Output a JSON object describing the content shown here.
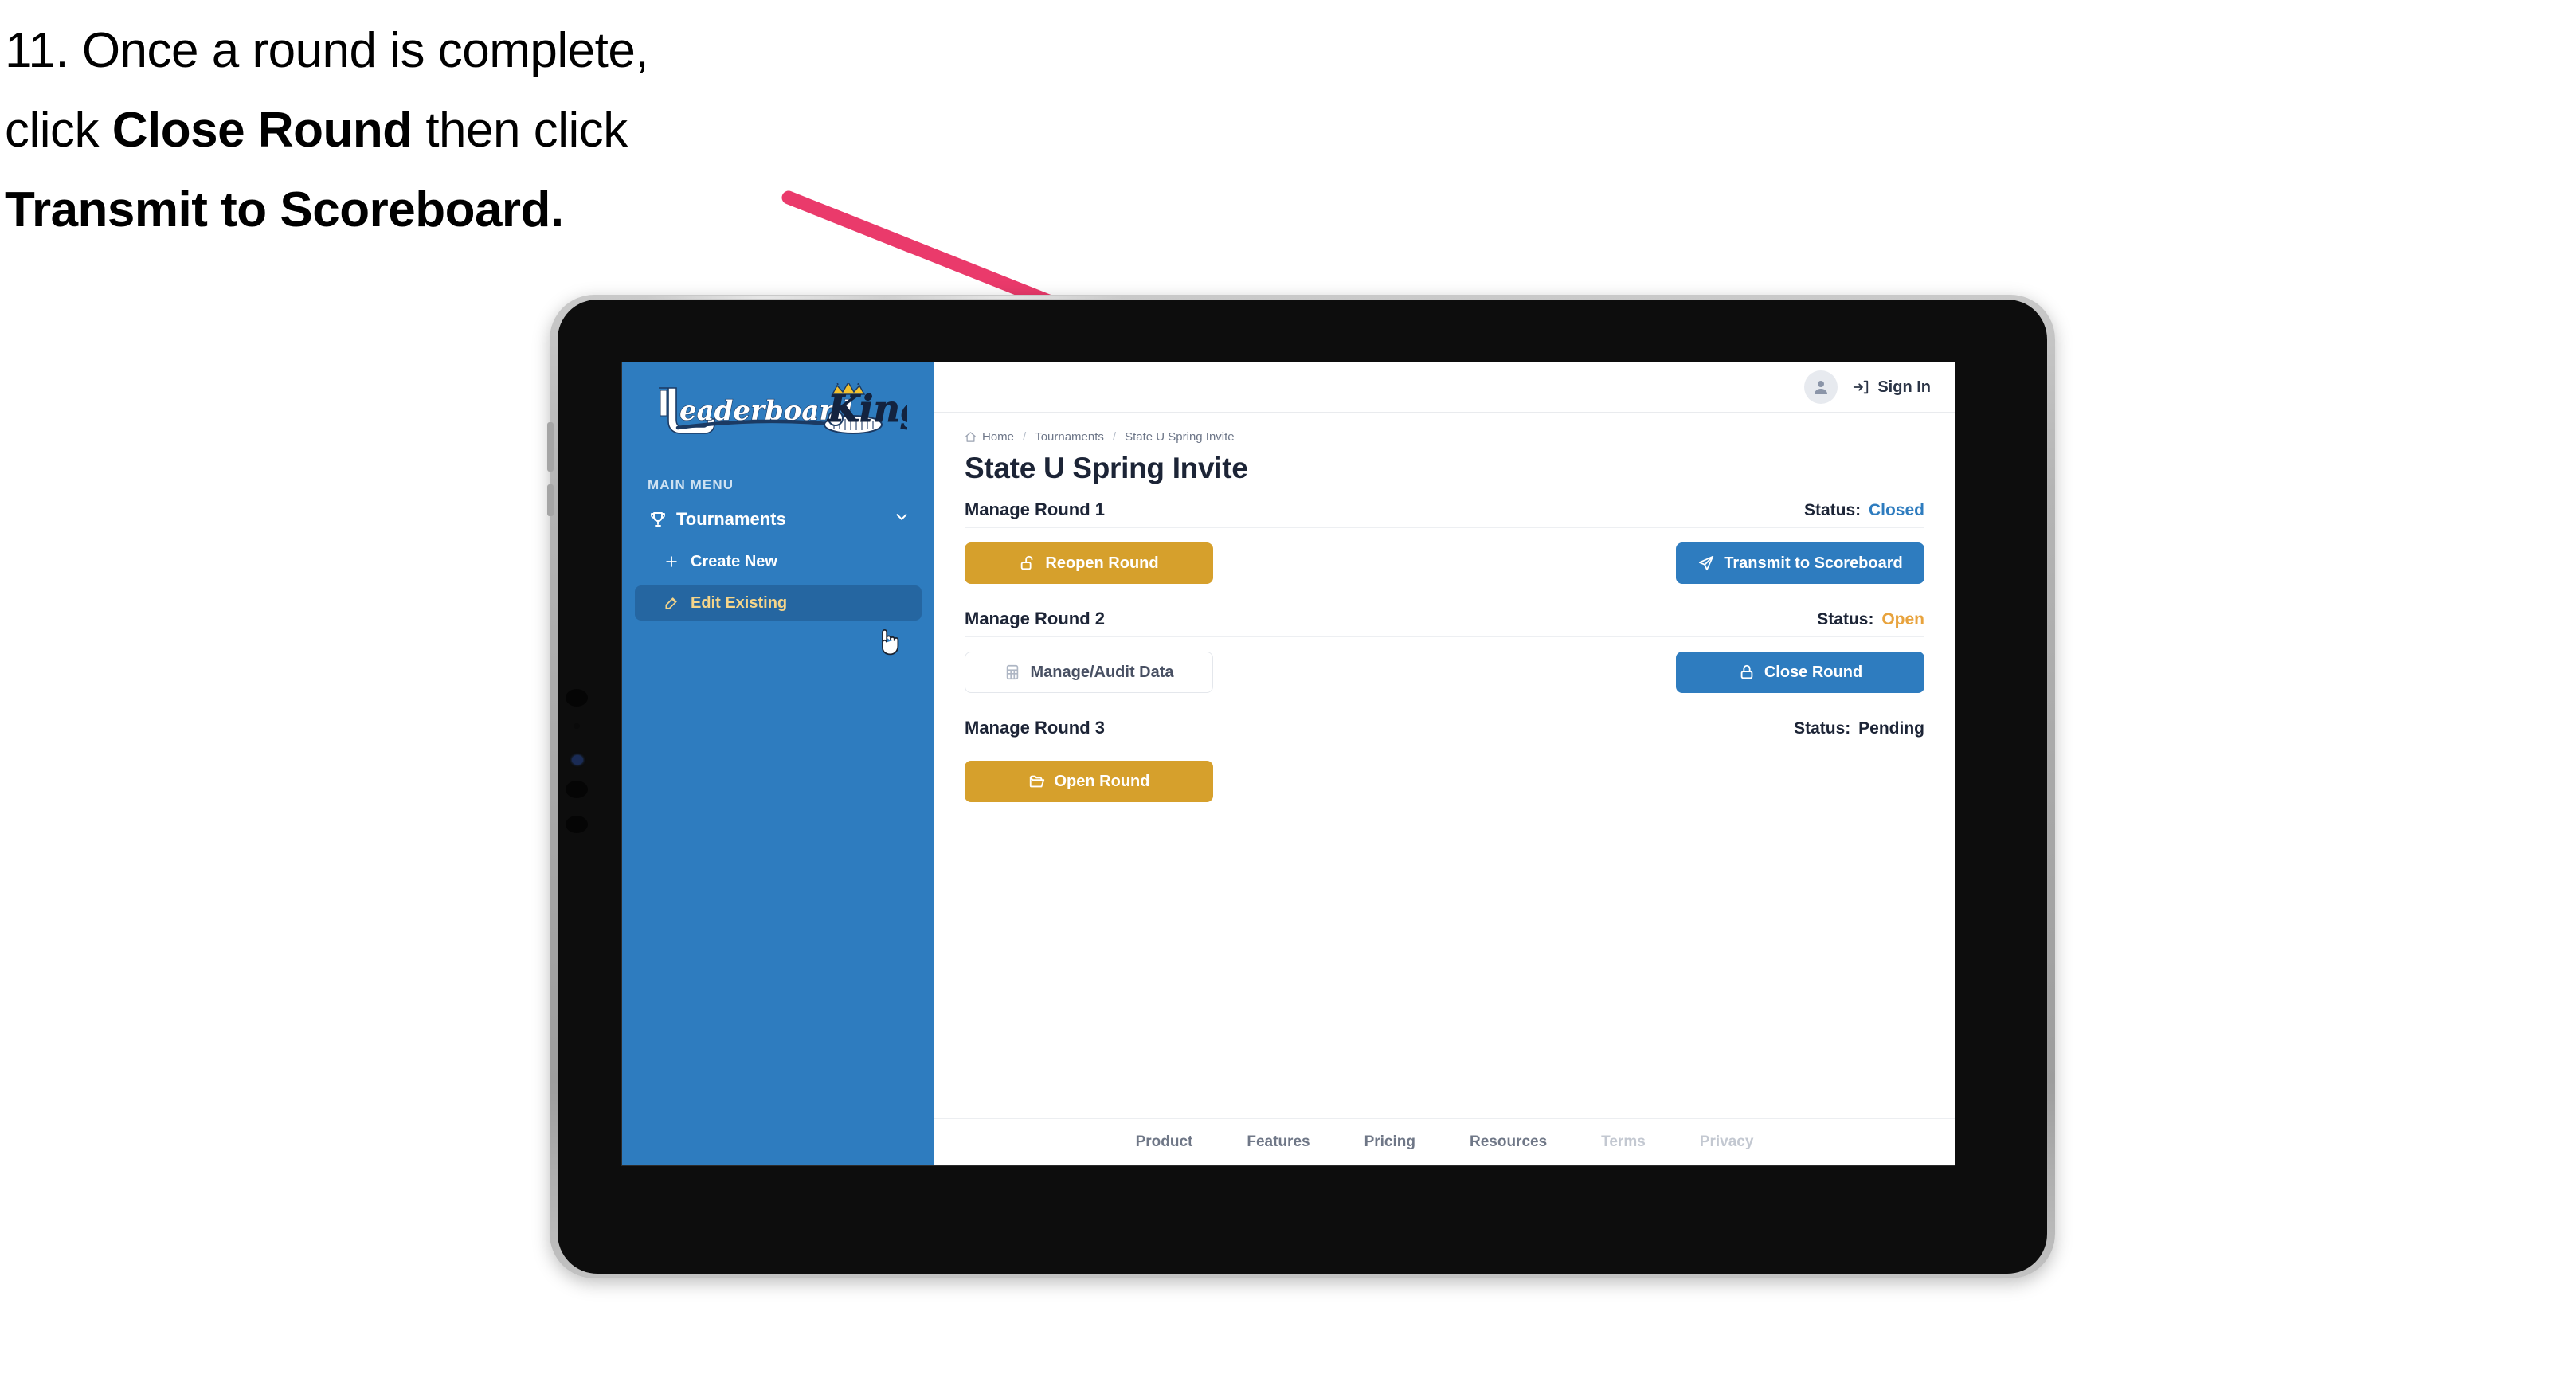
{
  "caption": {
    "number": "11.",
    "line1_a": "Once a round is complete,",
    "line2_a": "click ",
    "line2_bold": "Close Round",
    "line2_b": " then click",
    "line3_bold": "Transmit to Scoreboard."
  },
  "sidebar": {
    "logo_primary": "Leaderboard",
    "logo_secondary": "King",
    "section_label": "MAIN MENU",
    "items": [
      {
        "label": "Tournaments",
        "icon": "trophy-icon",
        "chevron": "chevron-down-icon",
        "active": false
      },
      {
        "label": "Create New",
        "icon": "plus-icon",
        "active": false
      },
      {
        "label": "Edit Existing",
        "icon": "edit-square-icon",
        "active": true
      }
    ]
  },
  "topbar": {
    "avatar_icon": "user-avatar-icon",
    "signin_icon": "sign-in-arrow-icon",
    "signin_label": "Sign In"
  },
  "breadcrumb": {
    "home_icon": "home-icon",
    "items": [
      "Home",
      "Tournaments",
      "State U Spring Invite"
    ],
    "separator": "/"
  },
  "page": {
    "title": "State U Spring Invite"
  },
  "rounds": [
    {
      "title": "Manage Round 1",
      "status_label": "Status:",
      "status_value": "Closed",
      "status_color": "#2e7cbf",
      "left_button": {
        "label": "Reopen Round",
        "icon": "unlock-icon",
        "style": "gold"
      },
      "right_button": {
        "label": "Transmit to Scoreboard",
        "icon": "paper-plane-icon",
        "style": "blue"
      }
    },
    {
      "title": "Manage Round 2",
      "status_label": "Status:",
      "status_value": "Open",
      "status_color": "#e8a33d",
      "left_button": {
        "label": "Manage/Audit Data",
        "icon": "table-grid-icon",
        "style": "ghost"
      },
      "right_button": {
        "label": "Close Round",
        "icon": "lock-icon",
        "style": "blue"
      }
    },
    {
      "title": "Manage Round 3",
      "status_label": "Status:",
      "status_value": "Pending",
      "status_color": "#1c2436",
      "left_button": {
        "label": "Open Round",
        "icon": "open-folder-icon",
        "style": "gold"
      },
      "right_button": null
    }
  ],
  "footer": {
    "links": [
      {
        "label": "Product",
        "muted": false
      },
      {
        "label": "Features",
        "muted": false
      },
      {
        "label": "Pricing",
        "muted": false
      },
      {
        "label": "Resources",
        "muted": false
      },
      {
        "label": "Terms",
        "muted": true
      },
      {
        "label": "Privacy",
        "muted": true
      }
    ]
  },
  "colors": {
    "sidebar_blue": "#2e7cbf",
    "sidebar_active": "#2566a1",
    "accent_gold": "#d6a02c",
    "annotation_pink": "#ea3a6b",
    "text_dark": "#1c2436"
  }
}
